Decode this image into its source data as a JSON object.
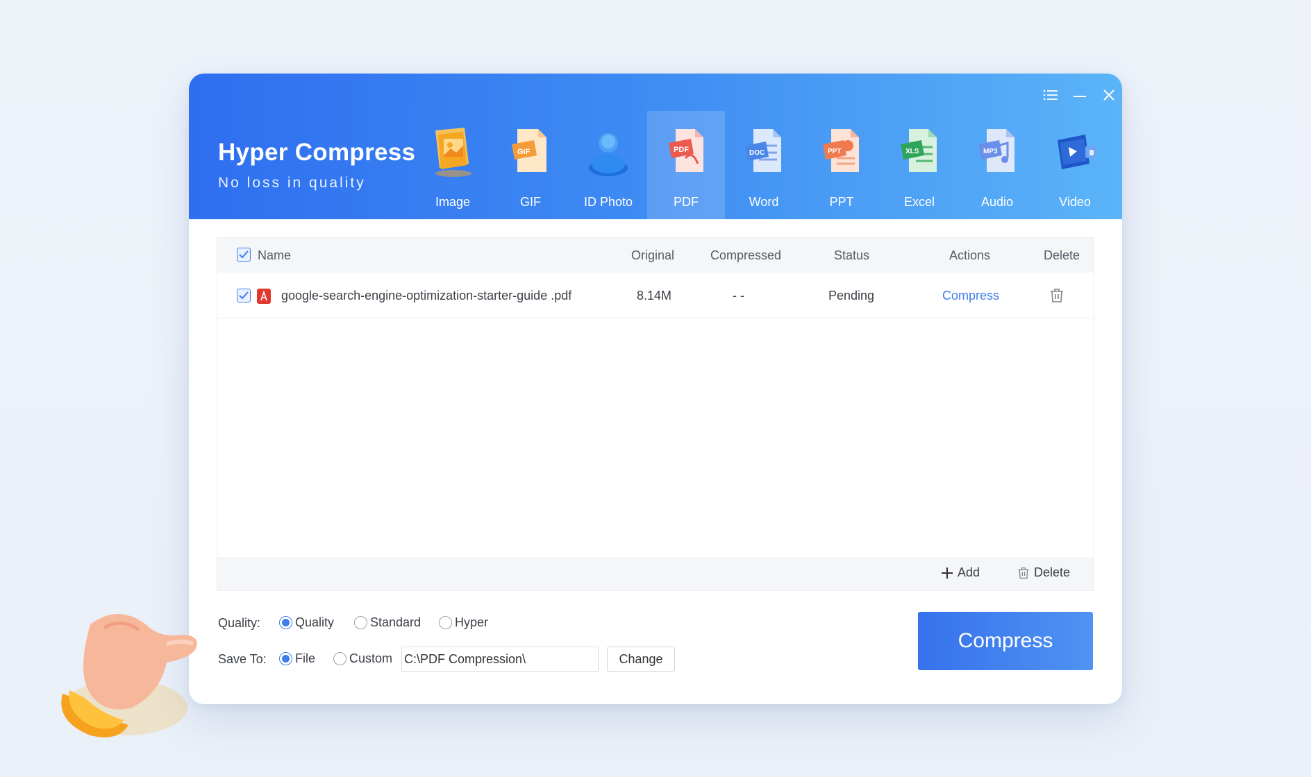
{
  "app": {
    "title": "Hyper Compress",
    "subtitle": "No loss in quality"
  },
  "window_controls": [
    "menu-icon",
    "minimize-icon",
    "close-icon"
  ],
  "nav": {
    "items": [
      {
        "label": "Image",
        "icon": "image-file-icon",
        "color": "#f5a623"
      },
      {
        "label": "GIF",
        "icon": "gif-file-icon",
        "color": "#f39c38"
      },
      {
        "label": "ID Photo",
        "icon": "id-photo-icon",
        "color": "#2f8bf0"
      },
      {
        "label": "PDF",
        "icon": "pdf-file-icon",
        "color": "#ec5a4e",
        "active": true
      },
      {
        "label": "Word",
        "icon": "word-file-icon",
        "color": "#4a86e8"
      },
      {
        "label": "PPT",
        "icon": "ppt-file-icon",
        "color": "#f07a4e"
      },
      {
        "label": "Excel",
        "icon": "excel-file-icon",
        "color": "#2fa55a"
      },
      {
        "label": "Audio",
        "icon": "audio-file-icon",
        "color": "#6a8fe8"
      },
      {
        "label": "Video",
        "icon": "video-file-icon",
        "color": "#2e6ad8"
      }
    ]
  },
  "table": {
    "headers": {
      "name": "Name",
      "original": "Original",
      "compressed": "Compressed",
      "status": "Status",
      "actions": "Actions",
      "delete": "Delete"
    },
    "rows": [
      {
        "checked": true,
        "name": "google-search-engine-optimization-starter-guide .pdf",
        "original": "8.14M",
        "compressed": "- -",
        "status": "Pending",
        "action": "Compress"
      }
    ],
    "footer": {
      "add_label": "Add",
      "delete_label": "Delete"
    }
  },
  "options": {
    "quality_label": "Quality:",
    "quality_options": [
      "Quality",
      "Standard",
      "Hyper"
    ],
    "quality_selected": "Quality",
    "save_label": "Save To:",
    "save_options": [
      "File",
      "Custom"
    ],
    "save_selected": "File",
    "path_value": "C:\\PDF Compression\\",
    "change_label": "Change"
  },
  "compress_button": "Compress",
  "colors": {
    "accent": "#3f7ee8",
    "header_start": "#2e6ef0",
    "header_end": "#5bb4f8",
    "link": "#3f7ee8"
  }
}
